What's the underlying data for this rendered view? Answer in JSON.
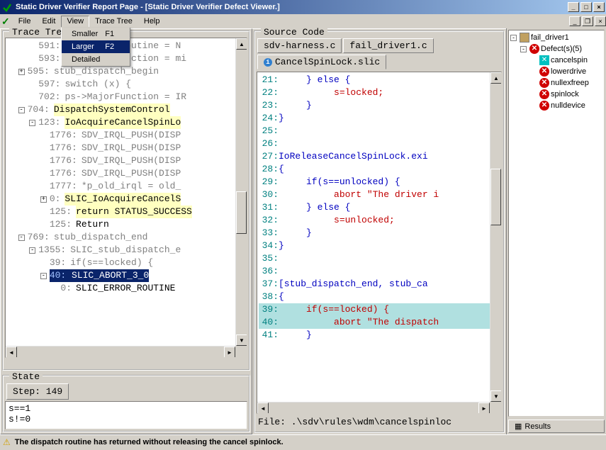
{
  "title": "Static Driver Verifier Report Page - [Static Driver Verifier Defect Viewer.]",
  "menubar": [
    "File",
    "Edit",
    "View",
    "Trace Tree",
    "Help"
  ],
  "view_dropdown": [
    {
      "label": "Smaller",
      "key": "F1",
      "sel": false
    },
    {
      "label": "Larger",
      "key": "F2",
      "sel": true
    },
    {
      "label": "Detailed",
      "key": "",
      "sel": false
    }
  ],
  "trace_legend": "Trace Tree",
  "trace_lines": [
    {
      "indent": 1,
      "toggle": "",
      "ln": "591:",
      "text": "ps->CancelRoutine = N",
      "cls": "code-gray"
    },
    {
      "indent": 1,
      "toggle": "",
      "ln": "593:",
      "text": "ps->MinorFunction = mi",
      "cls": "code-gray"
    },
    {
      "indent": 0,
      "toggle": "+",
      "ln": "595:",
      "text": "stub_dispatch_begin",
      "cls": "code-gray"
    },
    {
      "indent": 1,
      "toggle": "",
      "ln": "597:",
      "text": "switch (x) {",
      "cls": "code-gray"
    },
    {
      "indent": 1,
      "toggle": "",
      "ln": "702:",
      "text": "ps->MajorFunction = IR",
      "cls": "code-gray"
    },
    {
      "indent": 0,
      "toggle": "-",
      "ln": "704:",
      "text": "DispatchSystemControl",
      "cls": "code-hl"
    },
    {
      "indent": 1,
      "toggle": "-",
      "ln": "123:",
      "text": "IoAcquireCancelSpinLo",
      "cls": "code-hl"
    },
    {
      "indent": 2,
      "toggle": "",
      "ln": "1776:",
      "text": "SDV_IRQL_PUSH(DISP",
      "cls": "code-gray"
    },
    {
      "indent": 2,
      "toggle": "",
      "ln": "1776:",
      "text": "SDV_IRQL_PUSH(DISP",
      "cls": "code-gray"
    },
    {
      "indent": 2,
      "toggle": "",
      "ln": "1776:",
      "text": "SDV_IRQL_PUSH(DISP",
      "cls": "code-gray"
    },
    {
      "indent": 2,
      "toggle": "",
      "ln": "1776:",
      "text": "SDV_IRQL_PUSH(DISP",
      "cls": "code-gray"
    },
    {
      "indent": 2,
      "toggle": "",
      "ln": "1777:",
      "text": "*p_old_irql = old_",
      "cls": "code-gray"
    },
    {
      "indent": 2,
      "toggle": "+",
      "ln": "0:",
      "text": "SLIC_IoAcquireCancelS",
      "cls": "code-hl"
    },
    {
      "indent": 2,
      "toggle": "",
      "ln": "125:",
      "text": "return STATUS_SUCCESS",
      "cls": "code-hl"
    },
    {
      "indent": 2,
      "toggle": "",
      "ln": "125:",
      "text": "Return",
      "cls": ""
    },
    {
      "indent": 0,
      "toggle": "-",
      "ln": "769:",
      "text": "stub_dispatch_end",
      "cls": "code-gray"
    },
    {
      "indent": 1,
      "toggle": "-",
      "ln": "1355:",
      "text": "SLIC_stub_dispatch_e",
      "cls": "code-gray"
    },
    {
      "indent": 2,
      "toggle": "",
      "ln": "39:",
      "text": "if(s==locked) {",
      "cls": "code-gray"
    },
    {
      "indent": 2,
      "toggle": "-",
      "ln": "40:",
      "text": "SLIC_ABORT_3_0",
      "cls": "code-sel"
    },
    {
      "indent": 3,
      "toggle": "",
      "ln": "0:",
      "text": "SLIC_ERROR_ROUTINE",
      "cls": ""
    }
  ],
  "state_legend": "State",
  "step_label": "Step: 149",
  "state_lines": [
    "s==1",
    "s!=0"
  ],
  "source_legend": "Source Code",
  "tabs": [
    {
      "label": "sdv-harness.c",
      "active": false,
      "icon": false
    },
    {
      "label": "fail_driver1.c",
      "active": false,
      "icon": false
    },
    {
      "label": "CancelSpinLock.slic",
      "active": true,
      "icon": true
    }
  ],
  "source_lines": [
    {
      "n": "21:",
      "txt": "     } else {",
      "cls": "src-blue"
    },
    {
      "n": "22:",
      "txt": "          s=locked;",
      "cls": "src-red"
    },
    {
      "n": "23:",
      "txt": "     }",
      "cls": "src-blue"
    },
    {
      "n": "24:",
      "txt": "}",
      "cls": "src-blue"
    },
    {
      "n": "25:",
      "txt": "",
      "cls": ""
    },
    {
      "n": "26:",
      "txt": "",
      "cls": ""
    },
    {
      "n": "27:",
      "txt": "IoReleaseCancelSpinLock.exi",
      "cls": "src-blue"
    },
    {
      "n": "28:",
      "txt": "{",
      "cls": "src-blue"
    },
    {
      "n": "29:",
      "txt": "     if(s==unlocked) {",
      "cls": "src-blue"
    },
    {
      "n": "30:",
      "txt": "          abort \"The driver i",
      "cls": "src-red"
    },
    {
      "n": "31:",
      "txt": "     } else {",
      "cls": "src-blue"
    },
    {
      "n": "32:",
      "txt": "          s=unlocked;",
      "cls": "src-red"
    },
    {
      "n": "33:",
      "txt": "     }",
      "cls": "src-blue"
    },
    {
      "n": "34:",
      "txt": "}",
      "cls": "src-blue"
    },
    {
      "n": "35:",
      "txt": "",
      "cls": ""
    },
    {
      "n": "36:",
      "txt": "",
      "cls": ""
    },
    {
      "n": "37:",
      "txt": "[stub_dispatch_end, stub_ca",
      "cls": "src-blue"
    },
    {
      "n": "38:",
      "txt": "{",
      "cls": "src-blue"
    },
    {
      "n": "39:",
      "txt": "     if(s==locked) {",
      "cls": "src-red",
      "hl": true
    },
    {
      "n": "40:",
      "txt": "          abort \"The dispatch",
      "cls": "src-red",
      "hl": true
    },
    {
      "n": "41:",
      "txt": "     }",
      "cls": "src-blue"
    }
  ],
  "file_path": "File: .\\sdv\\rules\\wdm\\cancelspinloc",
  "tree": [
    {
      "indent": 0,
      "toggle": "-",
      "icon": "box",
      "label": "fail_driver1"
    },
    {
      "indent": 1,
      "toggle": "-",
      "icon": "err",
      "label": "Defect(s)(5)"
    },
    {
      "indent": 2,
      "toggle": "",
      "icon": "sel",
      "label": "cancelspin"
    },
    {
      "indent": 2,
      "toggle": "",
      "icon": "err",
      "label": "lowerdrive"
    },
    {
      "indent": 2,
      "toggle": "",
      "icon": "err",
      "label": "nullexfreep"
    },
    {
      "indent": 2,
      "toggle": "",
      "icon": "err",
      "label": "spinlock"
    },
    {
      "indent": 2,
      "toggle": "",
      "icon": "err",
      "label": "nulldevice"
    }
  ],
  "results_label": "Results",
  "status_text": "The dispatch routine has returned without releasing the cancel spinlock."
}
